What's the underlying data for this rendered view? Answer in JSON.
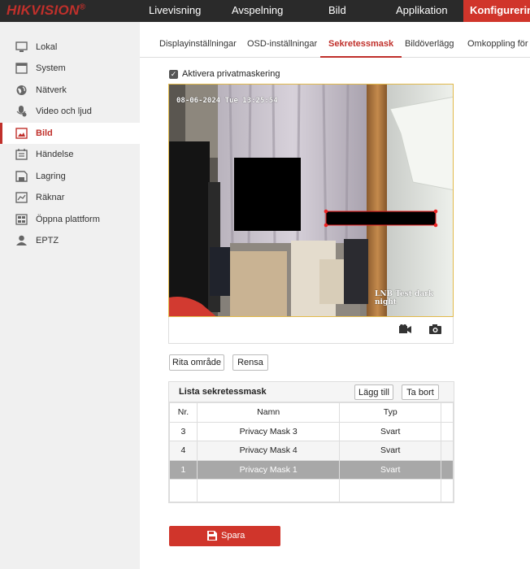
{
  "brand": {
    "name": "HIKVISION",
    "mark": "®"
  },
  "topnav": [
    "Livevisning",
    "Avspelning",
    "Bild",
    "Applikation",
    "Konfigurering"
  ],
  "sidebar": {
    "items": [
      {
        "label": "Lokal",
        "icon": "monitor-icon"
      },
      {
        "label": "System",
        "icon": "system-icon"
      },
      {
        "label": "Nätverk",
        "icon": "globe-icon"
      },
      {
        "label": "Video och ljud",
        "icon": "microphone-icon"
      },
      {
        "label": "Bild",
        "icon": "image-icon"
      },
      {
        "label": "Händelse",
        "icon": "calendar-icon"
      },
      {
        "label": "Lagring",
        "icon": "storage-icon"
      },
      {
        "label": "Räknar",
        "icon": "chart-icon"
      },
      {
        "label": "Öppna plattform",
        "icon": "grid-icon"
      },
      {
        "label": "EPTZ",
        "icon": "person-icon"
      }
    ],
    "active_index": 4
  },
  "tabs": [
    "Displayinställningar",
    "OSD-inställningar",
    "Sekretessmask",
    "Bildöverlägg",
    "Omkoppling för b"
  ],
  "active_tab": "Sekretessmask",
  "enable_privacy": {
    "label": "Aktivera privatmaskering",
    "checked": true
  },
  "video": {
    "osd_datetime": "08-06-2024 Tue 13:25:54",
    "osd_name": "LNB Test dark night"
  },
  "buttons": {
    "draw": "Rita område",
    "clear": "Rensa",
    "add": "Lägg till",
    "delete": "Ta bort",
    "save": "Spara"
  },
  "mask_list": {
    "title": "Lista sekretessmask",
    "columns": [
      "Nr.",
      "Namn",
      "Typ"
    ],
    "rows": [
      {
        "nr": "3",
        "name": "Privacy Mask 3",
        "type": "Svart",
        "selected": false
      },
      {
        "nr": "4",
        "name": "Privacy Mask 4",
        "type": "Svart",
        "selected": false
      },
      {
        "nr": "1",
        "name": "Privacy Mask 1",
        "type": "Svart",
        "selected": true
      }
    ]
  },
  "colors": {
    "accent": "#d0352b",
    "topbar": "#2a2a2a",
    "sidebar": "#f0f0f0",
    "selected_row": "#a8a8a8"
  }
}
